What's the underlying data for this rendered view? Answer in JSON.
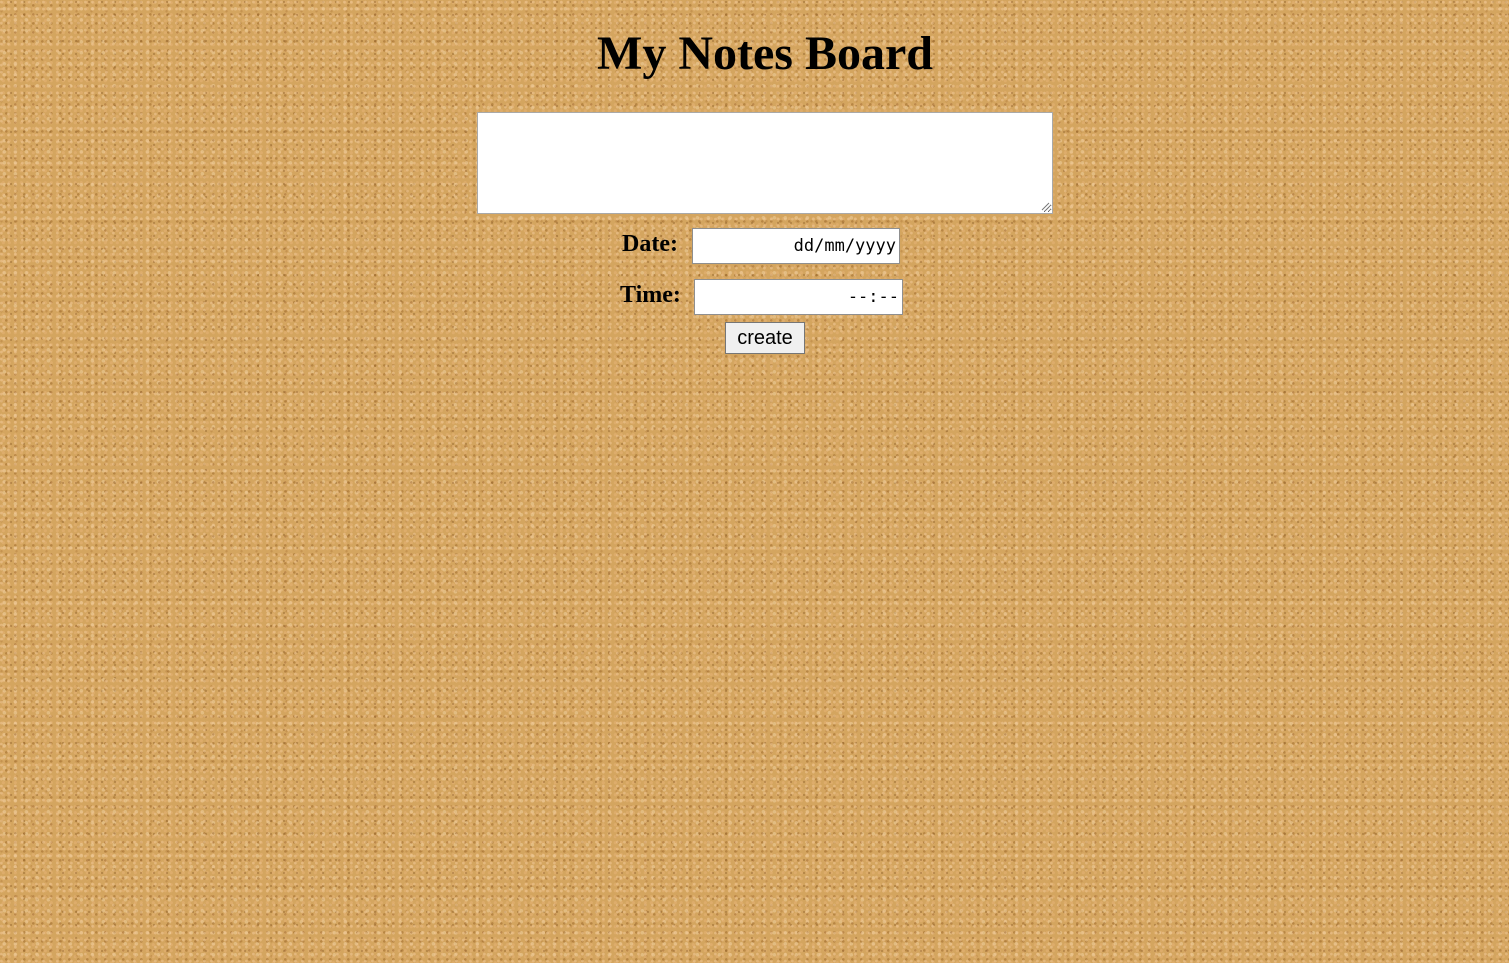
{
  "page": {
    "title": "My Notes Board",
    "background": "cork-board-texture"
  },
  "form": {
    "note_text": "",
    "date_label": "Date:",
    "date_placeholder": "dd/mm/yyyy",
    "time_label": "Time:",
    "time_placeholder": "--:--",
    "create_label": "create"
  },
  "colors": {
    "cork": "#d4a55f",
    "input_bg": "#ffffff",
    "button_bg": "#f0f0f0"
  }
}
